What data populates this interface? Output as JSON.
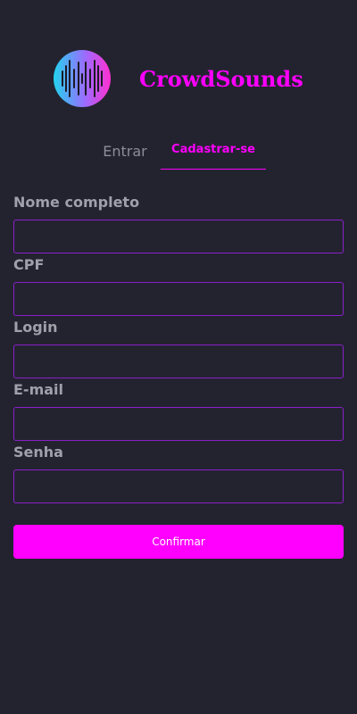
{
  "app": {
    "name": "CrowdSounds",
    "accent_color": "#ff00ff",
    "background_color": "#232330",
    "logo_icon": "sound-wave-icon"
  },
  "tabs": [
    {
      "label": "Entrar",
      "active": false
    },
    {
      "label": "Cadastrar-se",
      "active": true
    }
  ],
  "form": {
    "fields": [
      {
        "label": "Nome completo",
        "value": "",
        "placeholder": ""
      },
      {
        "label": "CPF",
        "value": "",
        "placeholder": ""
      },
      {
        "label": "Login",
        "value": "",
        "placeholder": ""
      },
      {
        "label": "E-mail",
        "value": "",
        "placeholder": ""
      },
      {
        "label": "Senha",
        "value": "",
        "placeholder": ""
      }
    ],
    "submit_label": "Confirmar"
  }
}
